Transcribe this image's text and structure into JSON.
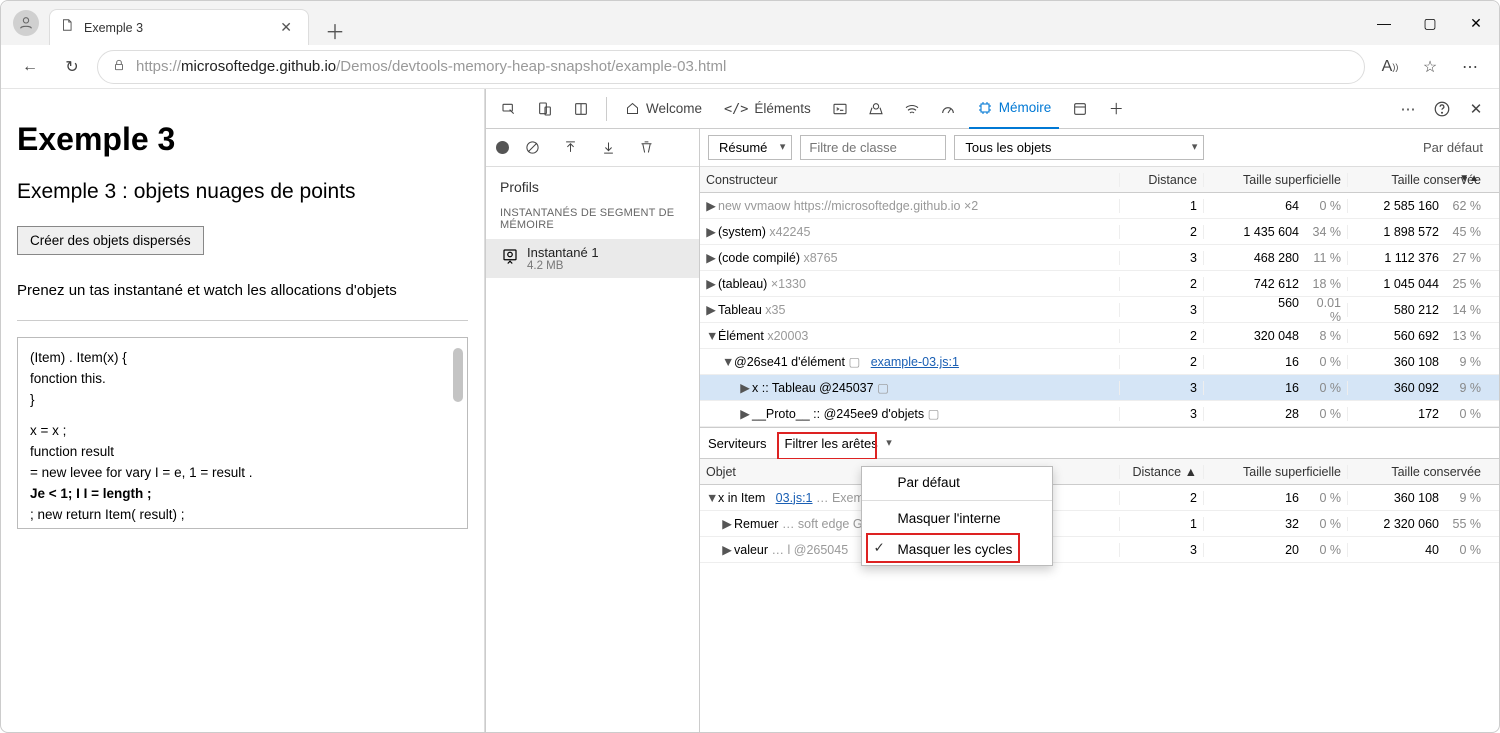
{
  "browser": {
    "tab_title": "Exemple 3",
    "url_prefix": "https://",
    "url_host": "microsoftedge.github.io",
    "url_path": "/Demos/devtools-memory-heap-snapshot/example-03.html"
  },
  "page": {
    "h1": "Exemple 3",
    "h2": "Exemple 3 : objets nuages de points",
    "button": "Créer des objets dispersés",
    "para": "Prenez un tas instantané et watch les allocations d'objets",
    "code_l1": "(Item) .        Item(x)  {",
    "code_l2": "    fonction this.",
    "code_l3": "}",
    "code_l4": "                   x = x ;",
    "code_l5": "                   function           result",
    "code_l6": "      = new levee for vary I             = e, 1 = result .",
    "code_l7": "Je < 1; I I                              = length ;",
    "code_l8": "       ; new return         Item( result) ;"
  },
  "devtools": {
    "tabs": {
      "welcome": "Welcome",
      "elements": "Éléments",
      "memory": "Mémoire"
    },
    "sidebar": {
      "profiles": "Profils",
      "heap_snapshots": "INSTANTANÉS DE SEGMENT DE MÉMOIRE",
      "snapshot_name": "Instantané 1",
      "snapshot_size": "4.2 MB"
    },
    "filters": {
      "summary": "Résumé",
      "class_filter": "Filtre de classe",
      "all_objects": "Tous les objets",
      "grouping": "Par défaut"
    },
    "columns": {
      "constructor": "Constructeur",
      "distance": "Distance",
      "shallow": "Taille superficielle",
      "retained": "Taille conservée",
      "object": "Objet"
    },
    "rows": [
      {
        "expander": "▶",
        "label": "new vvmaow",
        "suffix": "https://microsoftedge.github.io",
        "xcount": "×2",
        "dist": "1",
        "shal": "64",
        "shalp": "0 %",
        "ret": "2 585 160",
        "retp": "62 %",
        "gray": true
      },
      {
        "expander": "▶",
        "label": "(system)",
        "xcount": "x42245",
        "dist": "2",
        "shal": "1 435 604",
        "shalp": "34 %",
        "ret": "1 898 572",
        "retp": "45 %"
      },
      {
        "expander": "▶",
        "label": "(code compilé)",
        "xcount": "x8765",
        "dist": "3",
        "shal": "468 280",
        "shalp": "11 %",
        "ret": "1 112 376",
        "retp": "27 %"
      },
      {
        "expander": "▶",
        "label": "(tableau)",
        "xcount": "×1330",
        "dist": "2",
        "shal": "742 612",
        "shalp": "18 %",
        "ret": "1 045 044",
        "retp": "25 %"
      },
      {
        "expander": "▶",
        "label": "Tableau",
        "xcount": "x35",
        "dist": "3",
        "shal": "560",
        "shalp": "0.01 %",
        "ret": "580 212",
        "retp": "14 %"
      },
      {
        "expander": "▼",
        "label": "Élément",
        "xcount": "x20003",
        "dist": "2",
        "shal": "320 048",
        "shalp": "8 %",
        "ret": "560 692",
        "retp": "13 %"
      },
      {
        "indent": 1,
        "expander": "▼",
        "label": "@26se41 d'élément",
        "dotted": true,
        "link": "example-03.js:1",
        "dist": "2",
        "shal": "16",
        "shalp": "0 %",
        "ret": "360 108",
        "retp": "9 %"
      },
      {
        "indent": 2,
        "expander": "▶",
        "label": "x  ::  Tableau @245037",
        "dotted": true,
        "dist": "3",
        "shal": "16",
        "shalp": "0 %",
        "ret": "360 092",
        "retp": "9 %",
        "sel": true
      },
      {
        "indent": 2,
        "expander": "▶",
        "label": "__Proto__  ::  @245ee9 d'objets",
        "dotted": true,
        "dist": "3",
        "shal": "28",
        "shalp": "0 %",
        "ret": "172",
        "retp": "0 %"
      }
    ],
    "retainers": {
      "label": "Serviteurs",
      "filter": "Filtrer les arêtes",
      "menu": {
        "default": "Par défaut",
        "hide_internal": "Masquer l'interne",
        "hide_cycles": "Masquer les cycles"
      }
    },
    "retainer_rows": [
      {
        "expander": "▼",
        "label": "x in Item",
        "tail": "Exemple-",
        "link": "03.js:1",
        "dist": "2",
        "shal": "16",
        "shalp": "0 %",
        "ret": "360 108",
        "retp": "9 %"
      },
      {
        "indent": 1,
        "expander": "▶",
        "label": "Remuer",
        "tail": "soft edge GitHub :",
        "dist": "1",
        "shal": "32",
        "shalp": "0 %",
        "ret": "2 320 060",
        "retp": "55 %"
      },
      {
        "indent": 1,
        "expander": "▶",
        "label": "valeur",
        "tail": "l @265045",
        "dist": "3",
        "shal": "20",
        "shalp": "0 %",
        "ret": "40",
        "retp": "0 %"
      }
    ]
  }
}
